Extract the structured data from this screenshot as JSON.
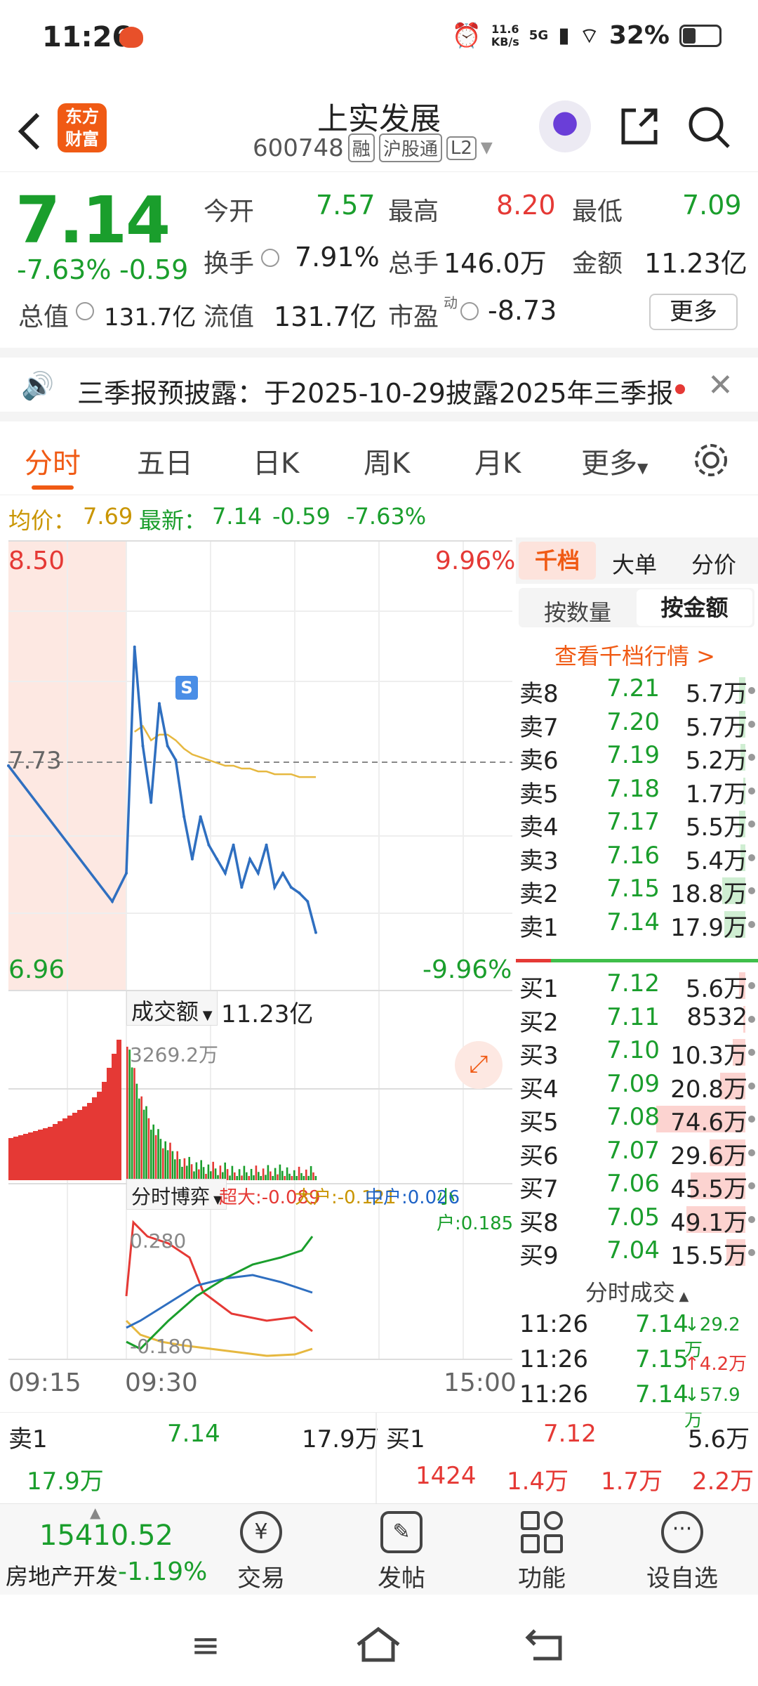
{
  "status_bar": {
    "time": "11:26",
    "net_speed_top": "11.6",
    "net_speed_bottom": "KB/s",
    "signal": "5G",
    "battery": "32%"
  },
  "header": {
    "stock_name": "上实发展",
    "stock_code": "600748",
    "tags": [
      "融",
      "沪股通",
      "L2"
    ],
    "logo_text": [
      "东方",
      "财富"
    ]
  },
  "quote": {
    "price": "7.14",
    "change_pct": "-7.63%",
    "change": "-0.59",
    "open_label": "今开",
    "open": "7.57",
    "high_label": "最高",
    "high": "8.20",
    "low_label": "最低",
    "low": "7.09",
    "turnover_label": "换手",
    "turnover": "7.91%",
    "volume_label": "总手",
    "volume": "146.0万",
    "amount_label": "金额",
    "amount": "11.23亿",
    "mktcap_label": "总值",
    "mktcap": "131.7亿",
    "float_label": "流值",
    "float": "131.7亿",
    "pe_label": "市盈",
    "pe_sup": "动",
    "pe": "-8.73",
    "more_button": "更多"
  },
  "notice": {
    "text": "三季报预披露：于2025-10-29披露2025年三季报"
  },
  "tabs": [
    "分时",
    "五日",
    "日K",
    "周K",
    "月K",
    "更多"
  ],
  "chart_info": {
    "avg_label": "均价：",
    "avg": "7.69",
    "latest_label": "最新：",
    "latest": "7.14",
    "change": "-0.59",
    "change_pct": "-7.63%"
  },
  "chart_labels": {
    "y_top": "8.50",
    "y_top_pct": "9.96%",
    "y_mid": "7.73",
    "y_bottom": "6.96",
    "y_bottom_pct": "-9.96%",
    "s_marker": "S",
    "amount_label": "成交额",
    "amount_value": "11.23亿",
    "volume_max": "3269.2万",
    "flow_label": "分时博弈",
    "flow_super": "超大:-0.089",
    "flow_large": "大户:-0.121",
    "flow_mid": "中户:0.026",
    "flow_small": "小户:0.185",
    "flow_top": "0.280",
    "flow_bottom": "-0.180",
    "t_start": "09:15",
    "t_open": "09:30",
    "t_end": "15:00"
  },
  "chart_data": {
    "type": "line",
    "title": "",
    "x": [
      "09:15",
      "09:25",
      "09:30",
      "09:35",
      "09:40",
      "09:45",
      "09:50",
      "09:55",
      "10:00",
      "10:05",
      "10:10",
      "10:15",
      "10:20",
      "10:25",
      "10:30",
      "10:35",
      "10:40",
      "10:45",
      "10:50",
      "10:55",
      "11:00",
      "11:05",
      "11:10",
      "11:15",
      "11:20",
      "11:26"
    ],
    "series": [
      {
        "name": "",
        "values": [
          7.73,
          7.25,
          7.35,
          8.15,
          7.8,
          7.6,
          7.95,
          7.8,
          7.75,
          7.55,
          7.4,
          7.55,
          7.45,
          7.4,
          7.35,
          7.45,
          7.3,
          7.4,
          7.35,
          7.45,
          7.3,
          7.35,
          7.3,
          7.28,
          7.25,
          7.14
        ]
      },
      {
        "name": "均价",
        "values": [
          null,
          null,
          null,
          7.85,
          7.87,
          7.82,
          7.84,
          7.84,
          7.82,
          7.79,
          7.77,
          7.76,
          7.75,
          7.74,
          7.73,
          7.73,
          7.72,
          7.72,
          7.71,
          7.71,
          7.7,
          7.7,
          7.7,
          7.69,
          7.69,
          7.69
        ]
      }
    ],
    "ylim": [
      6.96,
      8.5
    ]
  },
  "book": {
    "tabs": [
      "千档",
      "大单",
      "分价"
    ],
    "sub_tabs": [
      "按数量",
      "按金额"
    ],
    "view_more": "查看千档行情 >",
    "asks": [
      {
        "label": "卖8",
        "price": "7.21",
        "vol": "5.7万",
        "bar": 0.06
      },
      {
        "label": "卖7",
        "price": "7.20",
        "vol": "5.7万",
        "bar": 0.06
      },
      {
        "label": "卖6",
        "price": "7.19",
        "vol": "5.2万",
        "bar": 0.05
      },
      {
        "label": "卖5",
        "price": "7.18",
        "vol": "1.7万",
        "bar": 0.02
      },
      {
        "label": "卖4",
        "price": "7.17",
        "vol": "5.5万",
        "bar": 0.06
      },
      {
        "label": "卖3",
        "price": "7.16",
        "vol": "5.4万",
        "bar": 0.05
      },
      {
        "label": "卖2",
        "price": "7.15",
        "vol": "18.8万",
        "bar": 0.22
      },
      {
        "label": "卖1",
        "price": "7.14",
        "vol": "17.9万",
        "bar": 0.2
      }
    ],
    "bids": [
      {
        "label": "买1",
        "price": "7.12",
        "vol": "5.6万",
        "bar": 0.06
      },
      {
        "label": "买2",
        "price": "7.11",
        "vol": "8532",
        "bar": 0.02
      },
      {
        "label": "买3",
        "price": "7.10",
        "vol": "10.3万",
        "bar": 0.12
      },
      {
        "label": "买4",
        "price": "7.09",
        "vol": "20.8万",
        "bar": 0.24
      },
      {
        "label": "买5",
        "price": "7.08",
        "vol": "74.6万",
        "bar": 0.85
      },
      {
        "label": "买6",
        "price": "7.07",
        "vol": "29.6万",
        "bar": 0.34
      },
      {
        "label": "买7",
        "price": "7.06",
        "vol": "45.5万",
        "bar": 0.52
      },
      {
        "label": "买8",
        "price": "7.05",
        "vol": "49.1万",
        "bar": 0.56
      },
      {
        "label": "买9",
        "price": "7.04",
        "vol": "15.5万",
        "bar": 0.18
      }
    ],
    "trades_label": "分时成交",
    "trades": [
      {
        "time": "11:26",
        "price": "7.14",
        "dir": "↓",
        "vol": "29.2万"
      },
      {
        "time": "11:26",
        "price": "7.15",
        "dir": "↑",
        "vol": "4.2万"
      },
      {
        "time": "11:26",
        "price": "7.14",
        "dir": "↓",
        "vol": "57.9万"
      }
    ]
  },
  "level1": {
    "sell_label": "卖1",
    "sell_price": "7.14",
    "sell_vol": "17.9万",
    "sell_sub": "17.9万",
    "buy_label": "买1",
    "buy_price": "7.12",
    "buy_vol": "5.6万",
    "buy_sub": [
      "1424",
      "1.4万",
      "1.7万",
      "2.2万"
    ]
  },
  "bottom_nav": {
    "index_value": "15410.52",
    "index_name": "房地产开发",
    "index_change": "-1.19%",
    "items": [
      "交易",
      "发帖",
      "功能",
      "设自选"
    ]
  },
  "colors": {
    "up": "#e53935",
    "down": "#1a9e2c",
    "price_line": "#2f6fc0",
    "avg_line": "#e6b840",
    "brand": "#f05a14"
  }
}
